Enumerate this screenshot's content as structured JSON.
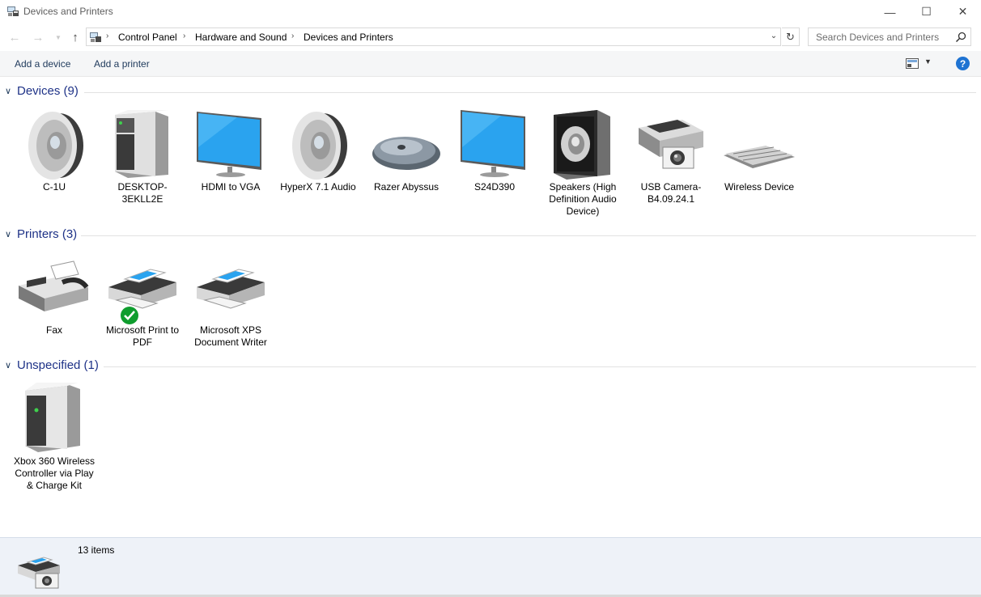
{
  "window": {
    "title": "Devices and Printers",
    "minimize_label": "—",
    "maximize_label": "☐",
    "close_label": "✕"
  },
  "address": {
    "crumbs": [
      "Control Panel",
      "Hardware and Sound",
      "Devices and Printers"
    ],
    "search_placeholder": "Search Devices and Printers"
  },
  "commands": {
    "add_device": "Add a device",
    "add_printer": "Add a printer",
    "help": "?"
  },
  "groups": {
    "devices": {
      "label": "Devices (9)",
      "items": [
        {
          "label": "C-1U",
          "icon": "speaker-icon"
        },
        {
          "label": "DESKTOP-3EKLL2E",
          "icon": "computer-tower-icon"
        },
        {
          "label": "HDMI to VGA",
          "icon": "monitor-icon"
        },
        {
          "label": "HyperX 7.1 Audio",
          "icon": "speaker-icon"
        },
        {
          "label": "Razer Abyssus",
          "icon": "mouse-icon"
        },
        {
          "label": "S24D390",
          "icon": "monitor-icon"
        },
        {
          "label": "Speakers (High Definition Audio Device)",
          "icon": "speaker-box-icon"
        },
        {
          "label": "USB Camera-B4.09.24.1",
          "icon": "camera-scanner-icon"
        },
        {
          "label": "Wireless Device",
          "icon": "keyboard-icon"
        }
      ]
    },
    "printers": {
      "label": "Printers (3)",
      "items": [
        {
          "label": "Fax",
          "icon": "fax-icon"
        },
        {
          "label": "Microsoft Print to PDF",
          "icon": "printer-icon",
          "default": true
        },
        {
          "label": "Microsoft XPS Document Writer",
          "icon": "printer-icon"
        }
      ]
    },
    "unspecified": {
      "label": "Unspecified (1)",
      "items": [
        {
          "label": "Xbox 360 Wireless Controller via Play & Charge Kit",
          "icon": "device-box-icon"
        }
      ]
    }
  },
  "status": {
    "count": "13 items"
  },
  "colors": {
    "group_header": "#1e3287",
    "command_text": "#1e395b",
    "status_bg": "#eef2f8",
    "default_check": "#0f9d2e",
    "monitor_screen": "#2aa3ef"
  }
}
